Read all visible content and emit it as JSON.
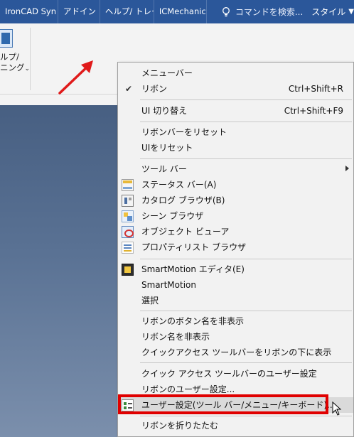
{
  "tabs": [
    {
      "label": "IronCAD Syn"
    },
    {
      "label": "アドイン"
    },
    {
      "label": "ヘルプ/ トレー"
    },
    {
      "label": "ICMechanic"
    }
  ],
  "tellme": {
    "placeholder": "コマンドを検索..."
  },
  "style_menu": {
    "label": "スタイル"
  },
  "ribbon": {
    "group_label_line1": "ルプ/",
    "group_label_line2": "ニング"
  },
  "colors": {
    "title_bar": "#2b579a",
    "menu_background": "#f2f2f2",
    "highlight_border": "#e00000",
    "arrow": "#e01a1a"
  },
  "menu": {
    "items": [
      {
        "label": "メニューバー",
        "shortcut": "",
        "checked": false,
        "icon": ""
      },
      {
        "label": "リボン",
        "shortcut": "Ctrl+Shift+R",
        "checked": true,
        "icon": ""
      },
      {
        "label": "UI 切り替え",
        "shortcut": "Ctrl+Shift+F9",
        "checked": false,
        "icon": ""
      },
      {
        "label": "リボンバーをリセット",
        "shortcut": "",
        "checked": false,
        "icon": ""
      },
      {
        "label": "UIをリセット",
        "shortcut": "",
        "checked": false,
        "icon": ""
      },
      {
        "label": "ツール バー",
        "shortcut": "",
        "checked": false,
        "icon": "",
        "submenu": true
      },
      {
        "label": "ステータス バー(A)",
        "shortcut": "",
        "checked": false,
        "icon": "status-bar-icon"
      },
      {
        "label": "カタログ ブラウザ(B)",
        "shortcut": "",
        "checked": false,
        "icon": "catalog-browser-icon"
      },
      {
        "label": "シーン ブラウザ",
        "shortcut": "",
        "checked": false,
        "icon": "scene-browser-icon"
      },
      {
        "label": "オブジェクト ビューア",
        "shortcut": "",
        "checked": false,
        "icon": "object-viewer-icon"
      },
      {
        "label": "プロパティリスト ブラウザ",
        "shortcut": "",
        "checked": false,
        "icon": "property-list-icon"
      },
      {
        "label": "SmartMotion エディタ(E)",
        "shortcut": "",
        "checked": false,
        "icon": "smartmotion-icon"
      },
      {
        "label": "SmartMotion",
        "shortcut": "",
        "checked": false,
        "icon": ""
      },
      {
        "label": "選択",
        "shortcut": "",
        "checked": false,
        "icon": ""
      },
      {
        "label": "リボンのボタン名を非表示",
        "shortcut": "",
        "checked": false,
        "icon": ""
      },
      {
        "label": "リボン名を非表示",
        "shortcut": "",
        "checked": false,
        "icon": ""
      },
      {
        "label": "クイックアクセス ツールバーをリボンの下に表示",
        "shortcut": "",
        "checked": false,
        "icon": ""
      },
      {
        "label": "クイック アクセス ツールバーのユーザー設定",
        "shortcut": "",
        "checked": false,
        "icon": ""
      },
      {
        "label": "リボンのユーザー設定...",
        "shortcut": "",
        "checked": false,
        "icon": ""
      },
      {
        "label": "ユーザー設定(ツール バー/メニュー/キーボード)...",
        "shortcut": "",
        "checked": false,
        "icon": "customize-icon",
        "highlighted": true
      },
      {
        "label": "リボンを折りたたむ",
        "shortcut": "",
        "checked": false,
        "icon": ""
      }
    ]
  }
}
